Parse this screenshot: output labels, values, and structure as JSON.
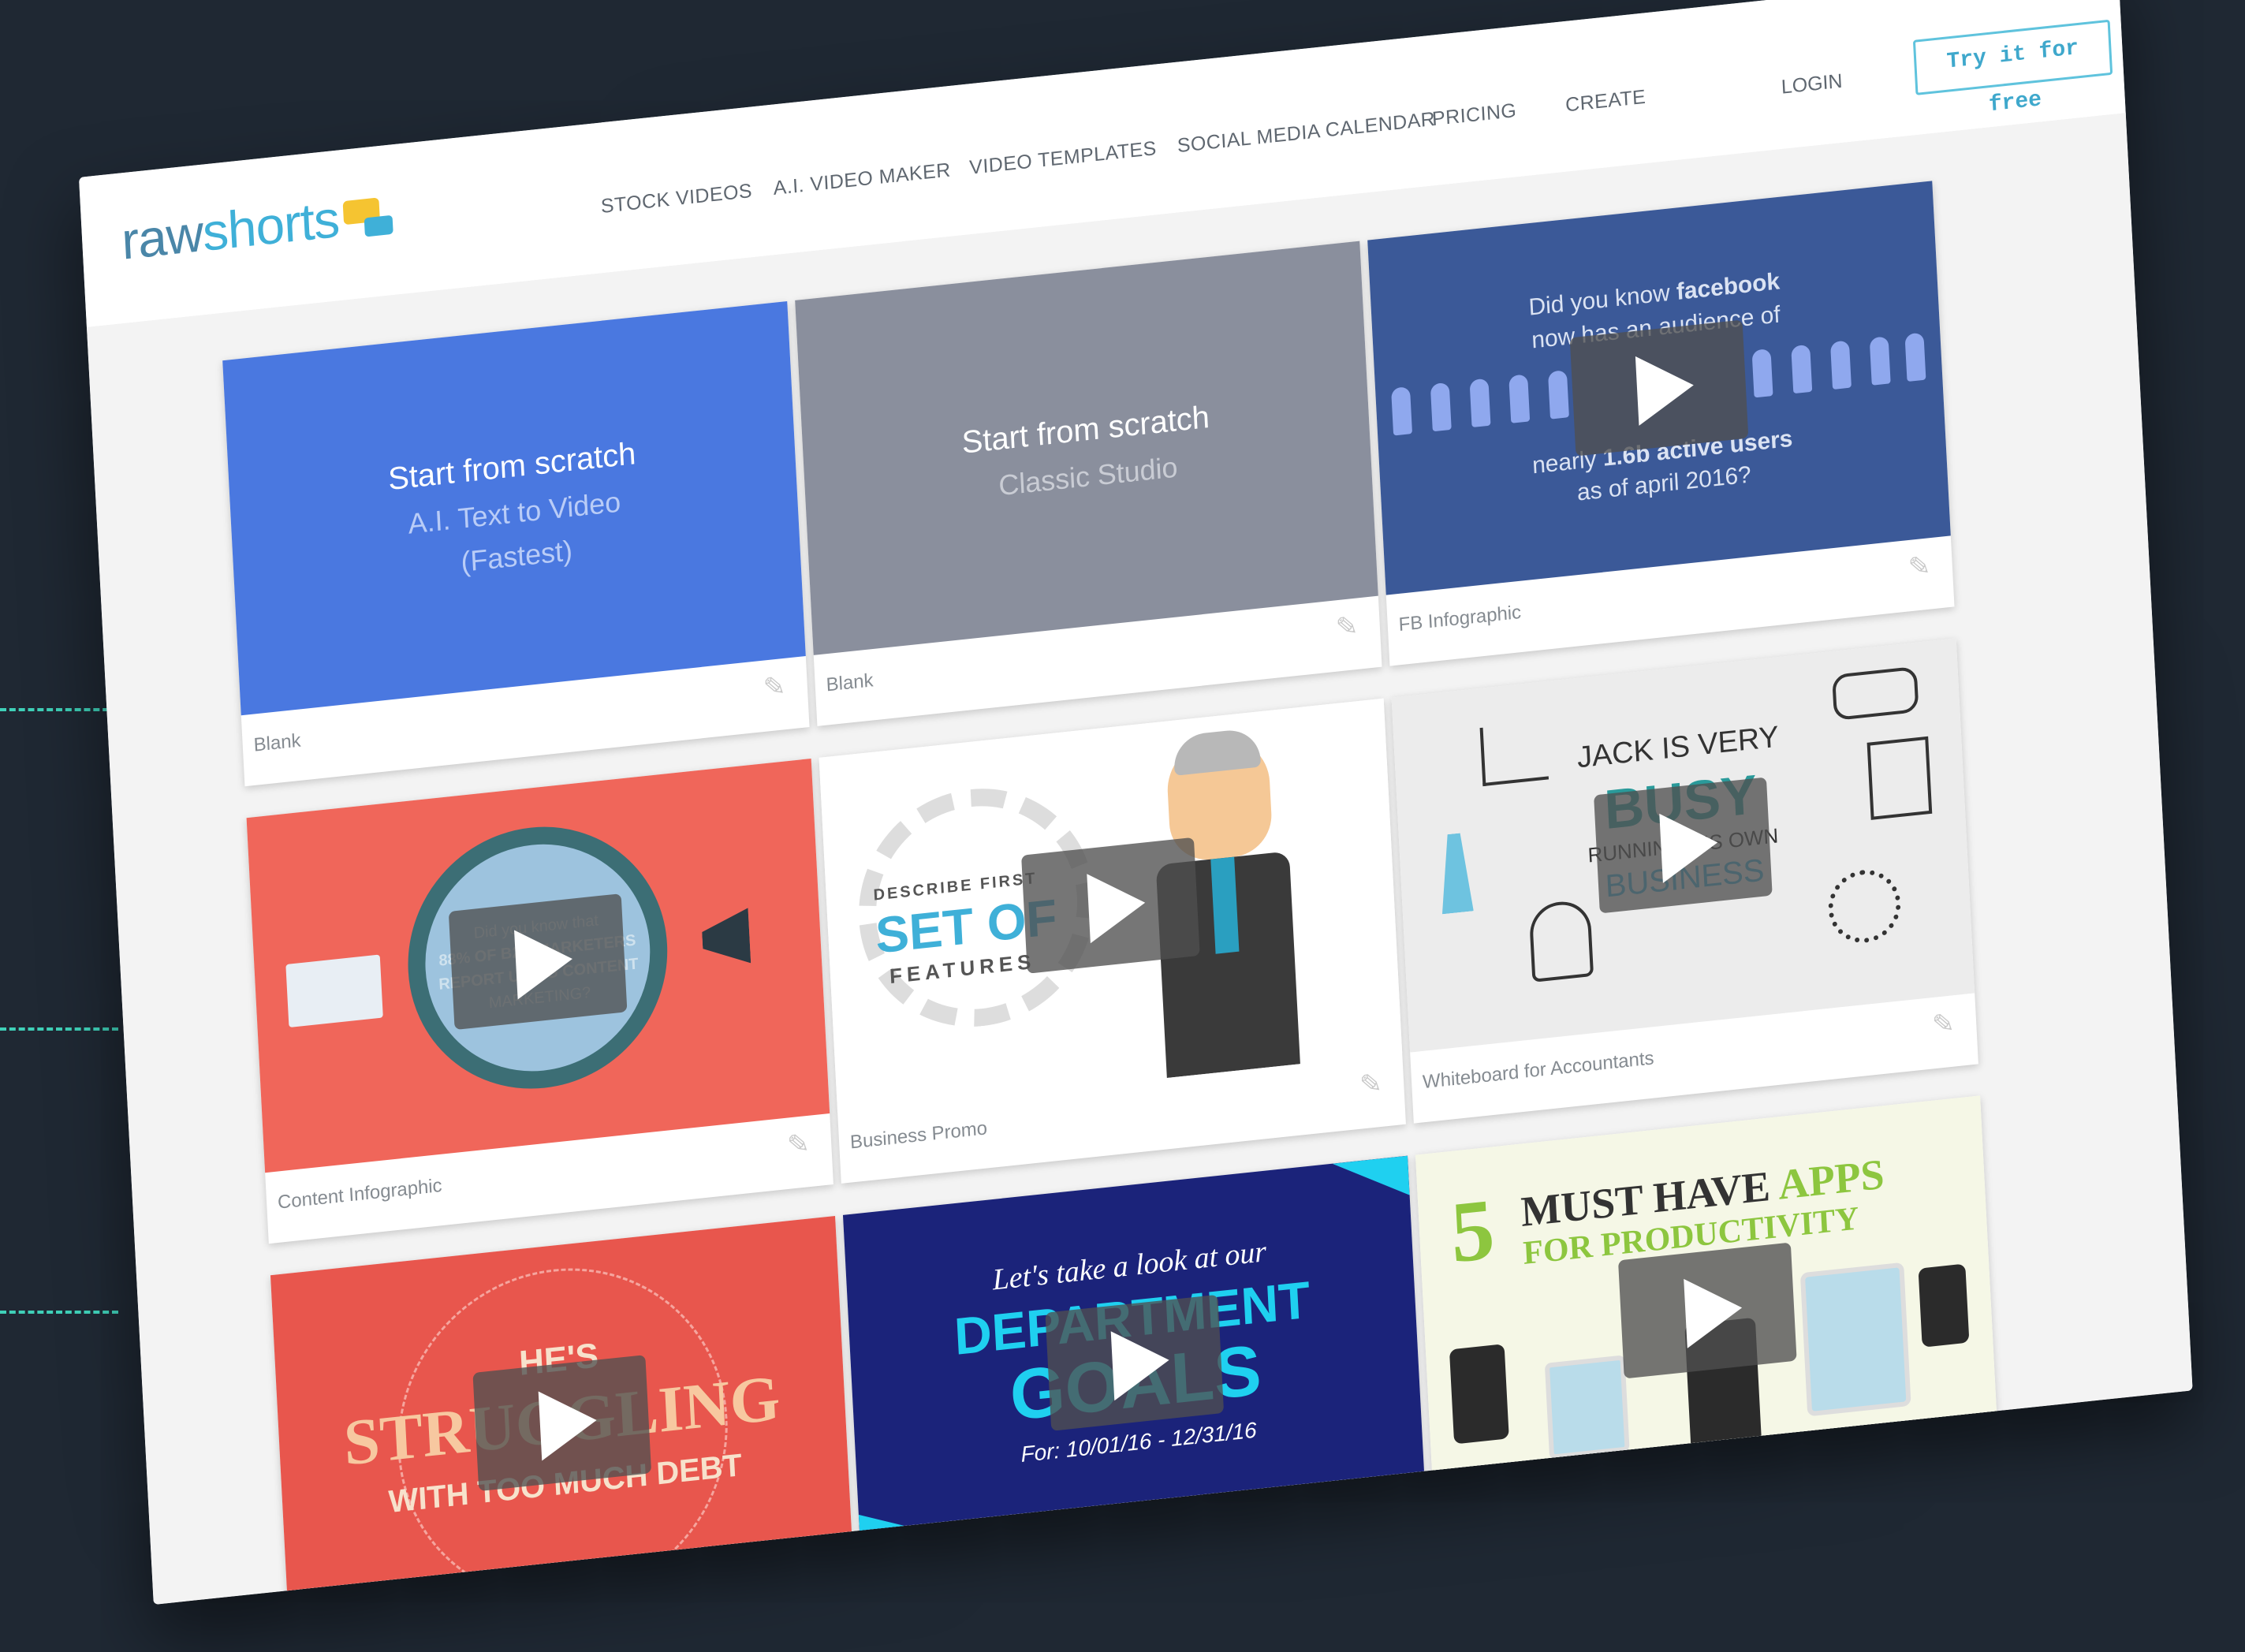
{
  "brand": {
    "logo_part1": "raw",
    "logo_part2": "shorts",
    "accent": "#3fb0d8",
    "background": "#1f2833"
  },
  "nav": {
    "items": [
      "STOCK VIDEOS",
      "A.I. VIDEO MAKER",
      "VIDEO TEMPLATES",
      "SOCIAL MEDIA CALENDAR",
      "PRICING",
      "CREATE"
    ],
    "login": "LOGIN",
    "cta": "Try it for free"
  },
  "templates": [
    {
      "label": "Blank",
      "title": "Start from scratch",
      "line2": "A.I. Text to Video",
      "line3": "(Fastest)"
    },
    {
      "label": "Blank",
      "title": "Start from scratch",
      "line2": "Classic Studio"
    },
    {
      "label": "FB Infographic",
      "text1": "Did you know",
      "text1b": "facebook",
      "text2": "now has an audience of",
      "text3": "nearly",
      "text3b": "1.6b active users",
      "text4": "as of april 2016?"
    },
    {
      "label": "Content Infographic",
      "text1": "Did you know that",
      "text2": "88% OF B2B MARKETERS",
      "text3": "REPORT USING CONTENT",
      "text4": "MARKETING?"
    },
    {
      "label": "Business Promo",
      "text1": "DESCRIBE FIRST",
      "text2": "SET OF",
      "text3": "FEATURES"
    },
    {
      "label": "Whiteboard for Accountants",
      "text1": "JACK IS VERY",
      "text2": "BUSY",
      "text3": "RUNNING HIS OWN",
      "text4": "BUSINESS"
    },
    {
      "label": "",
      "text1": "HE'S",
      "text2": "STRUGGLING",
      "text3": "WITH TOO MUCH DEBT"
    },
    {
      "label": "",
      "text1": "Let's take a look at our",
      "text2": "DEPARTMENT",
      "text3": "GOALS",
      "text4": "For: 10/01/16 - 12/31/16"
    },
    {
      "label": "",
      "text1": "5",
      "text2": "MUST HAVE",
      "text2b": "APPS",
      "text3": "FOR PRODUCTIVITY"
    }
  ]
}
